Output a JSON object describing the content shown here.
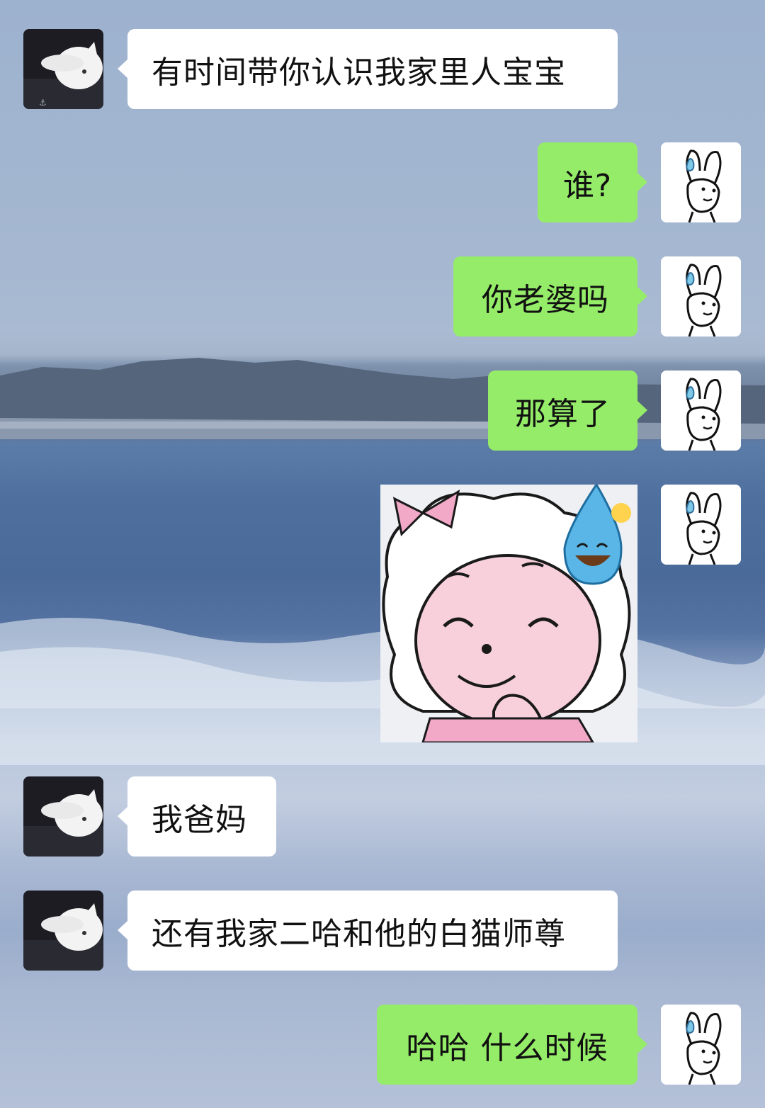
{
  "messages": [
    {
      "side": "left",
      "text": "有时间带你认识我家里人宝宝"
    },
    {
      "side": "right",
      "text": "谁?"
    },
    {
      "side": "right",
      "text": "你老婆吗"
    },
    {
      "side": "right",
      "text": "那算了"
    },
    {
      "side": "right",
      "type": "sticker",
      "sticker": "sheep-girl-sweat-smile-sticker"
    },
    {
      "side": "left",
      "text": "我爸妈"
    },
    {
      "side": "left",
      "text": "还有我家二哈和他的白猫师尊"
    },
    {
      "side": "right",
      "text": "哈哈 什么时候"
    }
  ],
  "colors": {
    "incoming_bubble": "#ffffff",
    "outgoing_bubble": "#95ec69"
  },
  "avatars": {
    "contact": "white-cat-avatar",
    "self": "sweating-bunny-avatar"
  }
}
